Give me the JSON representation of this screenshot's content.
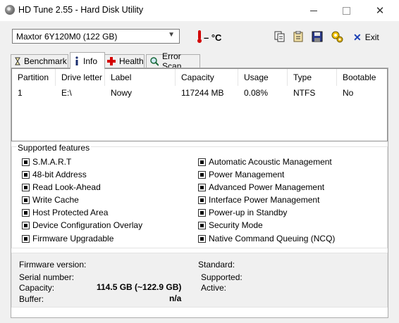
{
  "window": {
    "title": "HD Tune 2.55 - Hard Disk Utility"
  },
  "toolbar": {
    "drive": "Maxtor 6Y120M0 (122 GB)",
    "temperature": "– °C",
    "exit_label": "Exit"
  },
  "tabs": [
    {
      "label": "Benchmark",
      "icon": "benchmark-icon"
    },
    {
      "label": "Info",
      "icon": "info-icon"
    },
    {
      "label": "Health",
      "icon": "health-icon"
    },
    {
      "label": "Error Scan",
      "icon": "error-scan-icon"
    }
  ],
  "partition_table": {
    "columns": [
      "Partition",
      "Drive letter",
      "Label",
      "Capacity",
      "Usage",
      "Type",
      "Bootable"
    ],
    "rows": [
      [
        "1",
        "E:\\",
        "Nowy",
        "117244 MB",
        "0.08%",
        "NTFS",
        "No"
      ]
    ]
  },
  "features": {
    "title": "Supported features",
    "left": [
      "S.M.A.R.T",
      "48-bit Address",
      "Read Look-Ahead",
      "Write Cache",
      "Host Protected Area",
      "Device Configuration Overlay",
      "Firmware Upgradable"
    ],
    "right": [
      "Automatic Acoustic Management",
      "Power Management",
      "Advanced Power Management",
      "Interface Power Management",
      "Power-up in Standby",
      "Security Mode",
      "Native Command Queuing (NCQ)"
    ]
  },
  "info": {
    "firmware_label": "Firmware version:",
    "firmware_value": "",
    "serial_label": "Serial number:",
    "serial_value": "",
    "capacity_label": "Capacity:",
    "capacity_value": "114.5 GB (~122.9 GB)",
    "buffer_label": "Buffer:",
    "buffer_value": "n/a",
    "standard_label": "Standard:",
    "supported_label": "Supported:",
    "active_label": "Active:"
  }
}
